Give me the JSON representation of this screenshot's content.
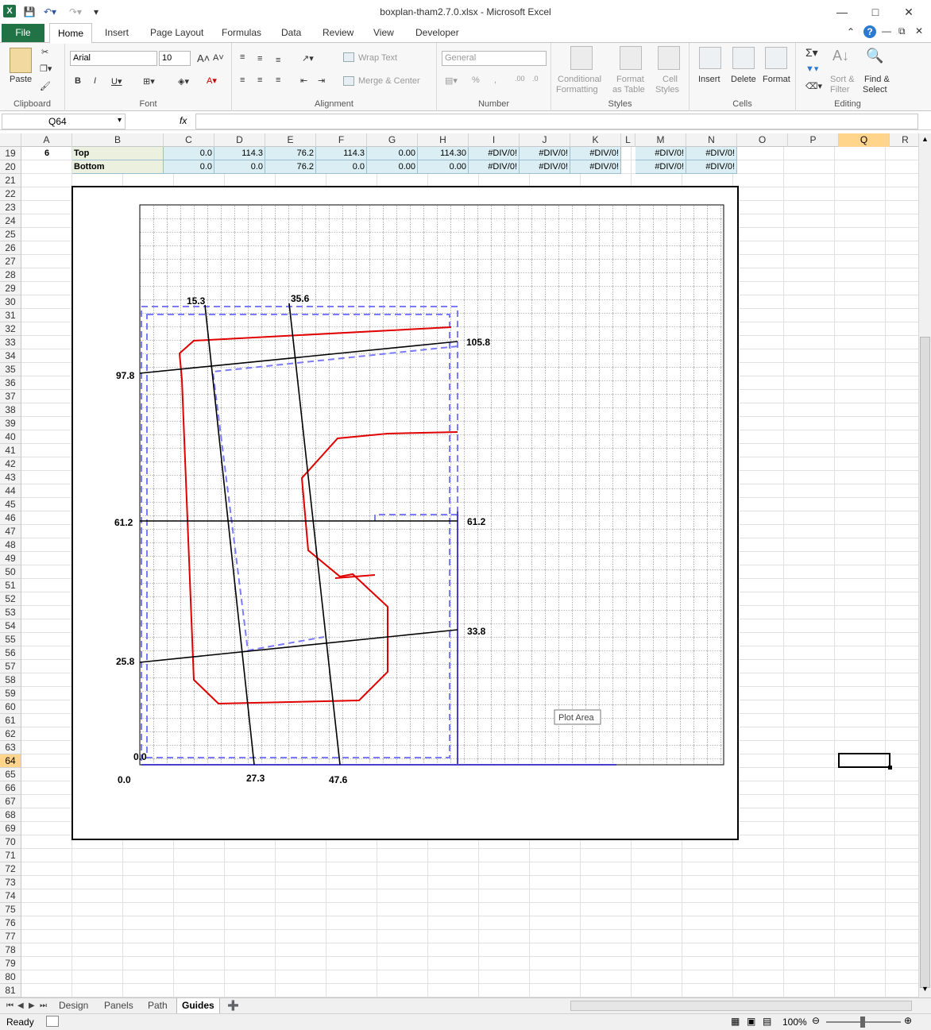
{
  "window": {
    "title": "boxplan-tham2.7.0.xlsx  -  Microsoft Excel"
  },
  "ribbon": {
    "tabs": [
      "File",
      "Home",
      "Insert",
      "Page Layout",
      "Formulas",
      "Data",
      "Review",
      "View",
      "Developer"
    ],
    "clipboard": {
      "label": "Clipboard",
      "paste": "Paste"
    },
    "font": {
      "label": "Font",
      "name": "Arial",
      "size": "10"
    },
    "alignment": {
      "label": "Alignment",
      "wrap": "Wrap Text",
      "merge": "Merge & Center"
    },
    "number": {
      "label": "Number",
      "format": "General"
    },
    "styles": {
      "label": "Styles",
      "cond1": "Conditional",
      "cond2": "Formatting",
      "fmt1": "Format",
      "fmt2": "as Table",
      "cell1": "Cell",
      "cell2": "Styles"
    },
    "cells": {
      "label": "Cells",
      "insert": "Insert",
      "delete": "Delete",
      "format": "Format"
    },
    "editing": {
      "label": "Editing",
      "sort1": "Sort &",
      "sort2": "Filter",
      "find1": "Find &",
      "find2": "Select"
    }
  },
  "formula_bar": {
    "name_box": "Q64",
    "fx": "fx",
    "value": ""
  },
  "columns": [
    "A",
    "B",
    "C",
    "D",
    "E",
    "F",
    "G",
    "H",
    "I",
    "J",
    "K",
    "L",
    "M",
    "N",
    "O",
    "P",
    "Q",
    "R"
  ],
  "selected_column": "Q",
  "selected_row": "64",
  "rows": {
    "first": 19,
    "last": 81
  },
  "table": {
    "r19": {
      "a": "6",
      "b": "Top",
      "c": "0.0",
      "d": "114.3",
      "e": "76.2",
      "f": "114.3",
      "g": "0.00",
      "h": "114.30",
      "i": "#DIV/0!",
      "j": "#DIV/0!",
      "k": "#DIV/0!",
      "m": "#DIV/0!",
      "n": "#DIV/0!"
    },
    "r20": {
      "b": "Bottom",
      "c": "0.0",
      "d": "0.0",
      "e": "76.2",
      "f": "0.0",
      "g": "0.00",
      "h": "0.00",
      "i": "#DIV/0!",
      "j": "#DIV/0!",
      "k": "#DIV/0!",
      "m": "#DIV/0!",
      "n": "#DIV/0!"
    }
  },
  "chart_labels": {
    "l153": "15.3",
    "l356": "35.6",
    "l1058": "105.8",
    "l978": "97.8",
    "l612a": "61.2",
    "l612b": "61.2",
    "l338": "33.8",
    "l258": "25.8",
    "l00a": "0.0",
    "l00b": "0.0",
    "l273": "27.3",
    "l476": "47.6"
  },
  "tooltip": "Plot Area",
  "colors": {
    "guide": "#000000",
    "path": "#e00000",
    "panel": "#7b7bff",
    "frame": "#4a3fc8"
  },
  "sheet_tabs": [
    "Design",
    "Panels",
    "Path",
    "Guides"
  ],
  "active_sheet": "Guides",
  "status": {
    "ready": "Ready",
    "zoom": "100%"
  }
}
